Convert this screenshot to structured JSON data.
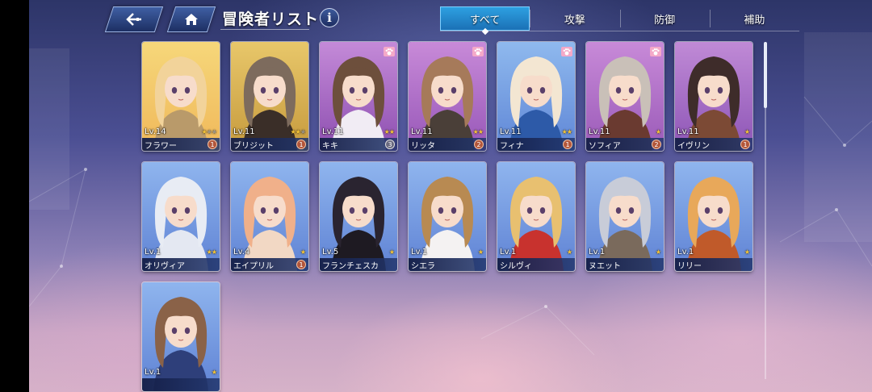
{
  "header": {
    "title": "冒険者リスト",
    "info_label": "i"
  },
  "tabs": [
    {
      "label": "すべて",
      "active": true
    },
    {
      "label": "攻撃",
      "active": false
    },
    {
      "label": "防御",
      "active": false
    },
    {
      "label": "補助",
      "active": false
    }
  ],
  "cards": [
    {
      "level": "Lv.14",
      "name": "フラワー",
      "stars": 3,
      "lit": 1,
      "badge": "1",
      "paw": false,
      "hair": "#f2d39a",
      "bg1": "#f6d77a",
      "bg2": "#f0b85a",
      "outfit": "#b99a6a"
    },
    {
      "level": "Lv.11",
      "name": "ブリジット",
      "stars": 3,
      "lit": 2,
      "badge": "1",
      "paw": false,
      "hair": "#7d6b5d",
      "bg1": "#e8c76a",
      "bg2": "#c69a3d",
      "outfit": "#3a2e28"
    },
    {
      "level": "Lv.11",
      "name": "キキ",
      "stars": 2,
      "lit": 2,
      "badge": "3",
      "paw": true,
      "hair": "#6d4f3c",
      "bg1": "#c48ad8",
      "bg2": "#8d4fb0",
      "outfit": "#f1ecf4"
    },
    {
      "level": "Lv.11",
      "name": "リッタ",
      "stars": 2,
      "lit": 2,
      "badge": "2",
      "paw": true,
      "hair": "#a67a5a",
      "bg1": "#c88ad8",
      "bg2": "#9757b8",
      "outfit": "#4a3f38"
    },
    {
      "level": "Lv.11",
      "name": "フィナ",
      "stars": 2,
      "lit": 2,
      "badge": "1",
      "paw": true,
      "hair": "#f3e6d2",
      "bg1": "#8fb9ee",
      "bg2": "#5f86d6",
      "outfit": "#2d5aa8"
    },
    {
      "level": "Lv.11",
      "name": "ソフィア",
      "stars": 1,
      "lit": 1,
      "badge": "2",
      "paw": true,
      "hair": "#c9c0b8",
      "bg1": "#c88ad8",
      "bg2": "#9a5ab8",
      "outfit": "#6a3a30"
    },
    {
      "level": "Lv.11",
      "name": "イヴリン",
      "stars": 1,
      "lit": 1,
      "badge": "1",
      "paw": false,
      "hair": "#3e2c2a",
      "bg1": "#c08ad6",
      "bg2": "#8d55b6",
      "outfit": "#7c4a35"
    },
    {
      "level": "Lv.1",
      "name": "オリヴィア",
      "stars": 2,
      "lit": 2,
      "badge": "",
      "paw": false,
      "hair": "#e8ecf4",
      "bg1": "#8fb5ee",
      "bg2": "#5f82d4",
      "outfit": "#e4e8f2"
    },
    {
      "level": "Lv.4",
      "name": "エイプリル",
      "stars": 1,
      "lit": 1,
      "badge": "1",
      "paw": false,
      "hair": "#f0b08a",
      "bg1": "#8fb5ee",
      "bg2": "#5f82d4",
      "outfit": "#f2d8c4"
    },
    {
      "level": "Lv.5",
      "name": "フランチェスカ",
      "stars": 1,
      "lit": 1,
      "badge": "",
      "paw": false,
      "hair": "#2a2430",
      "bg1": "#8fb5ee",
      "bg2": "#5f82d4",
      "outfit": "#1e1a22"
    },
    {
      "level": "Lv.1",
      "name": "シエラ",
      "stars": 1,
      "lit": 1,
      "badge": "",
      "paw": false,
      "hair": "#b88a52",
      "bg1": "#8fb5ee",
      "bg2": "#5f82d4",
      "outfit": "#f4f2f2"
    },
    {
      "level": "Lv.1",
      "name": "シルヴィ",
      "stars": 1,
      "lit": 1,
      "badge": "",
      "paw": false,
      "hair": "#e8c070",
      "bg1": "#8fb5ee",
      "bg2": "#5f82d4",
      "outfit": "#c8322e"
    },
    {
      "level": "Lv.1",
      "name": "ヌエット",
      "stars": 1,
      "lit": 1,
      "badge": "",
      "paw": false,
      "hair": "#c8ccd8",
      "bg1": "#8fb5ee",
      "bg2": "#5f82d4",
      "outfit": "#7a6a5c"
    },
    {
      "level": "Lv.1",
      "name": "リリー",
      "stars": 1,
      "lit": 1,
      "badge": "",
      "paw": false,
      "hair": "#e8a85a",
      "bg1": "#8fb5ee",
      "bg2": "#5f82d4",
      "outfit": "#c05a2a"
    },
    {
      "level": "Lv.1",
      "name": "",
      "stars": 1,
      "lit": 1,
      "badge": "",
      "paw": false,
      "hair": "#8a6248",
      "bg1": "#8fb5ee",
      "bg2": "#5f82d4",
      "outfit": "#2e3f7a"
    }
  ]
}
